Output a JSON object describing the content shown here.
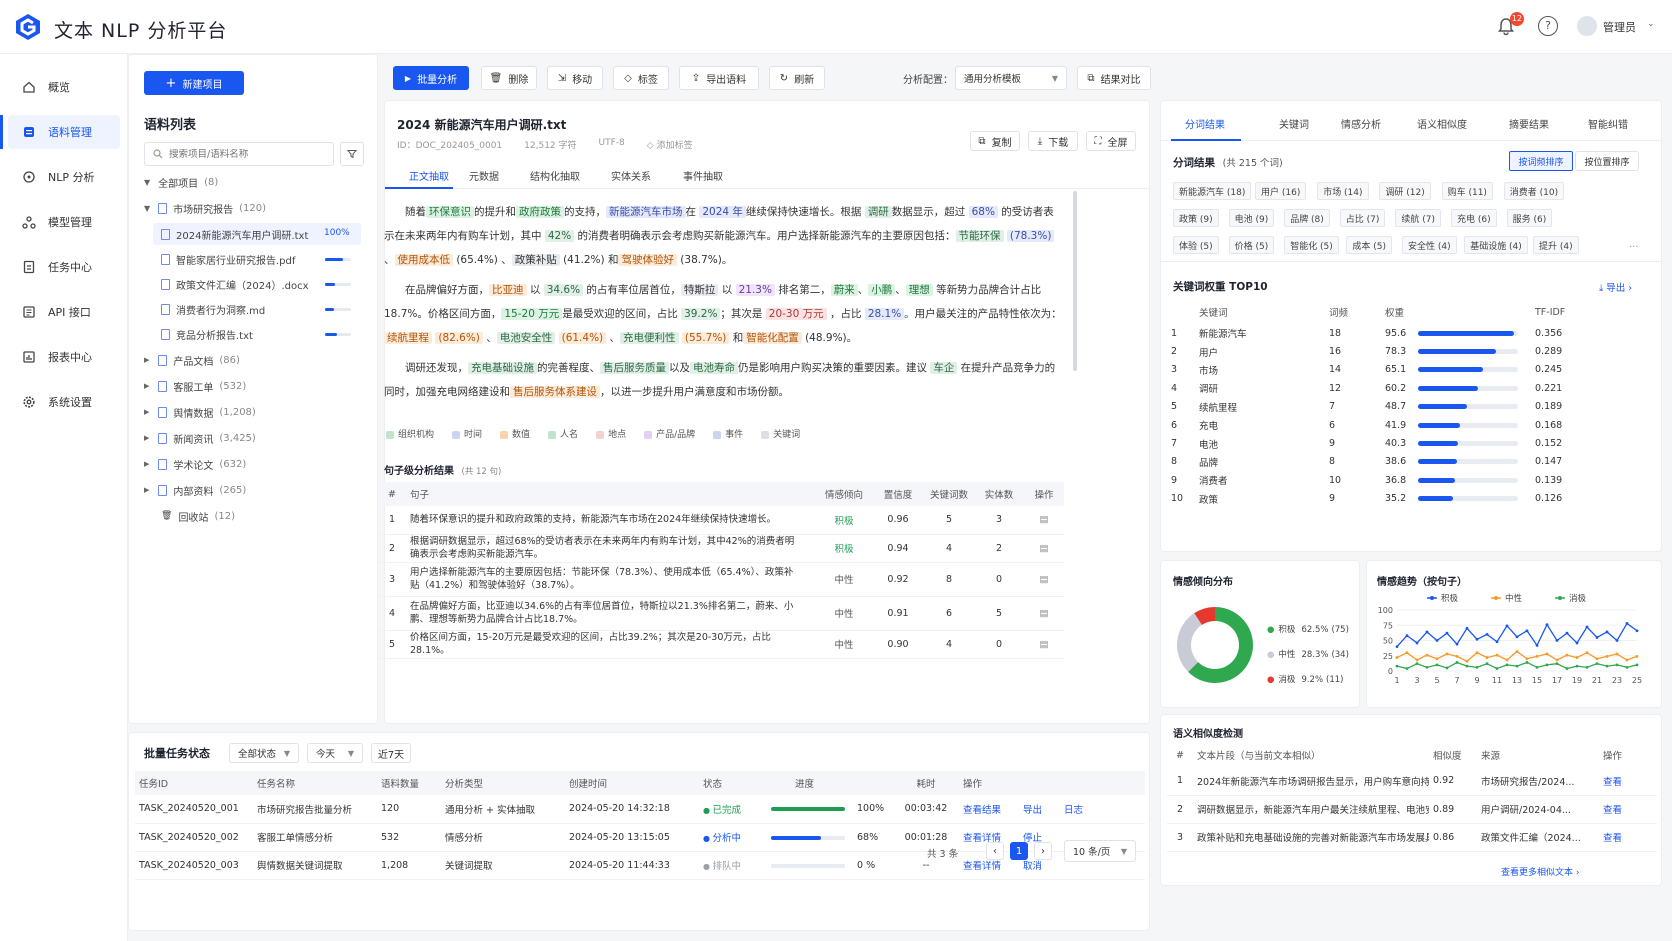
{
  "app": {
    "title": "文本 NLP 分析平台",
    "notif_count": "12",
    "user": "管理员"
  },
  "nav": {
    "items": [
      {
        "label": "概览",
        "icon": "home-icon"
      },
      {
        "label": "语料管理",
        "icon": "database-icon",
        "active": true
      },
      {
        "label": "NLP 分析",
        "icon": "nlp-icon"
      },
      {
        "label": "模型管理",
        "icon": "model-icon"
      },
      {
        "label": "任务中心",
        "icon": "task-icon"
      },
      {
        "label": "API 接口",
        "icon": "api-icon"
      },
      {
        "label": "报表中心",
        "icon": "report-icon"
      },
      {
        "label": "系统设置",
        "icon": "settings-icon"
      }
    ]
  },
  "corpus": {
    "new_button": "新建项目",
    "title": "语料列表",
    "search_placeholder": "搜索项目/语料名称",
    "all": {
      "label": "全部项目",
      "count": "(8)"
    },
    "market": {
      "label": "市场研究报告",
      "count": "(120)"
    },
    "files": [
      {
        "name": "2024新能源汽车用户调研.txt",
        "progress_text": "100%",
        "progress": 1.0,
        "active": true
      },
      {
        "name": "智能家居行业研究报告.pdf",
        "progress": 0.7
      },
      {
        "name": "政策文件汇编（2024）.docx",
        "progress": 0.4
      },
      {
        "name": "消费者行为洞察.md",
        "progress": 0.35
      },
      {
        "name": "竞品分析报告.txt",
        "progress": 0.45
      }
    ],
    "groups": [
      {
        "label": "产品文档",
        "count": "(86)"
      },
      {
        "label": "客服工单",
        "count": "(532)"
      },
      {
        "label": "舆情数据",
        "count": "(1,208)"
      },
      {
        "label": "新闻资讯",
        "count": "(3,425)"
      },
      {
        "label": "学术论文",
        "count": "(632)"
      },
      {
        "label": "内部资料",
        "count": "(265)"
      }
    ],
    "trash": {
      "label": "回收站",
      "count": "(12)"
    }
  },
  "toolbar": {
    "batch": "批量分析",
    "delete": "删除",
    "move": "移动",
    "tag": "标签",
    "export": "导出语料",
    "refresh": "刷新",
    "config_label": "分析配置：",
    "config_value": "通用分析模板",
    "compare": "结果对比"
  },
  "doc": {
    "title": "2024 新能源汽车用户调研.txt",
    "id": "ID：DOC_202405_0001",
    "chars": "12,512 字符",
    "encoding": "UTF-8",
    "add_tag": "添加标签",
    "copy": "复制",
    "download": "下载",
    "fullscreen": "全屏",
    "tabs": [
      "正文抽取",
      "元数据",
      "结构化抽取",
      "实体关系",
      "事件抽取"
    ],
    "legend": [
      "组织机构",
      "时间",
      "数值",
      "人名",
      "地点",
      "产品/品牌",
      "事件",
      "关键词"
    ]
  },
  "sentences": {
    "title": "句子级分析结果",
    "count": "(共 12 句)",
    "headers": [
      "#",
      "句子",
      "情感倾向",
      "置信度",
      "关键词数",
      "实体数",
      "操作"
    ],
    "rows": [
      {
        "n": "1",
        "text": "随着环保意识的提升和政府政策的支持，新能源汽车市场在2024年继续保持快速增长。",
        "sent": "积极",
        "conf": "0.96",
        "kw": "5",
        "ent": "3"
      },
      {
        "n": "2",
        "text": "根据调研数据显示，超过68%的受访者表示在未来两年内有购车计划，其中42%的消费者明确表示会考虑购买新能源汽车。",
        "sent": "积极",
        "conf": "0.94",
        "kw": "4",
        "ent": "2"
      },
      {
        "n": "3",
        "text": "用户选择新能源汽车的主要原因包括：节能环保（78.3%）、使用成本低（65.4%）、政策补贴（41.2%）和驾驶体验好（38.7%）。",
        "sent": "中性",
        "conf": "0.92",
        "kw": "8",
        "ent": "0"
      },
      {
        "n": "4",
        "text": "在品牌偏好方面，比亚迪以34.6%的占有率位居首位，特斯拉以21.3%排名第二，蔚来、小鹏、理想等新势力品牌合计占比18.7%。",
        "sent": "中性",
        "conf": "0.91",
        "kw": "6",
        "ent": "5"
      },
      {
        "n": "5",
        "text": "价格区间方面，15-20万元是最受欢迎的区间，占比39.2%；其次是20-30万元，占比28.1%。",
        "sent": "中性",
        "conf": "0.90",
        "kw": "4",
        "ent": "0"
      }
    ]
  },
  "tasks": {
    "title": "批量任务状态",
    "filter_status": "全部状态",
    "filter_day": "今天",
    "filter_7": "近7天",
    "headers": [
      "任务ID",
      "任务名称",
      "语料数量",
      "分析类型",
      "创建时间",
      "状态",
      "进度",
      "耗时",
      "操作"
    ],
    "rows": [
      {
        "id": "TASK_20240520_001",
        "name": "市场研究报告批量分析",
        "n": "120",
        "type": "通用分析 + 实体抽取",
        "time": "2024-05-20 14:32:18",
        "status": "已完成",
        "status_color": "#1f9d55",
        "progress": 1.0,
        "pct": "100%",
        "dur": "00:03:42",
        "a1": "查看结果",
        "a2": "导出",
        "a3": "日志"
      },
      {
        "id": "TASK_20240520_002",
        "name": "客服工单情感分析",
        "n": "532",
        "type": "情感分析",
        "time": "2024-05-20 13:15:05",
        "status": "分析中",
        "status_color": "#1a56f0",
        "progress": 0.68,
        "pct": "68%",
        "dur": "00:01:28",
        "a1": "查看详情",
        "a2": "停止",
        "a3": ""
      },
      {
        "id": "TASK_20240520_003",
        "name": "舆情数据关键词提取",
        "n": "1,208",
        "type": "关键词提取",
        "time": "2024-05-20 11:44:33",
        "status": "排队中",
        "status_color": "#9aa0ab",
        "progress": 0.0,
        "pct": "0 %",
        "dur": "--",
        "a1": "查看详情",
        "a2": "取消",
        "a3": ""
      }
    ],
    "total": "共 3 条",
    "page": "1",
    "page_size": "10 条/页"
  },
  "seg": {
    "tabs": [
      "分词结果",
      "关键词",
      "情感分析",
      "语义相似度",
      "摘要结果",
      "智能纠错"
    ],
    "title": "分词结果",
    "count": "(共 215 个词)",
    "sort_freq": "按词频排序",
    "sort_pos": "按位置排序",
    "tags": [
      [
        "新能源汽车 (18)",
        "用户 (16)",
        "市场 (14)",
        "调研 (12)",
        "购车 (11)",
        "消费者 (10)"
      ],
      [
        "政策 (9)",
        "电池 (9)",
        "品牌 (8)",
        "占比 (7)",
        "续航 (7)",
        "充电 (6)",
        "服务 (6)"
      ],
      [
        "体验 (5)",
        "价格 (5)",
        "智能化 (5)",
        "成本 (5)",
        "安全性 (4)",
        "基础设施 (4)",
        "提升 (4)"
      ]
    ],
    "more": "..."
  },
  "kw": {
    "title": "关键词权重 TOP10",
    "export": "导出",
    "headers": [
      "关键词",
      "词频",
      "权重",
      "TF-IDF"
    ],
    "rows": [
      {
        "n": "1",
        "word": "新能源汽车",
        "freq": "18",
        "w": "95.6",
        "tfidf": "0.356"
      },
      {
        "n": "2",
        "word": "用户",
        "freq": "16",
        "w": "78.3",
        "tfidf": "0.289"
      },
      {
        "n": "3",
        "word": "市场",
        "freq": "14",
        "w": "65.1",
        "tfidf": "0.245"
      },
      {
        "n": "4",
        "word": "调研",
        "freq": "12",
        "w": "60.2",
        "tfidf": "0.221"
      },
      {
        "n": "5",
        "word": "续航里程",
        "freq": "7",
        "w": "48.7",
        "tfidf": "0.189"
      },
      {
        "n": "6",
        "word": "充电",
        "freq": "6",
        "w": "41.9",
        "tfidf": "0.168"
      },
      {
        "n": "7",
        "word": "电池",
        "freq": "9",
        "w": "40.3",
        "tfidf": "0.152"
      },
      {
        "n": "8",
        "word": "品牌",
        "freq": "8",
        "w": "38.6",
        "tfidf": "0.147"
      },
      {
        "n": "9",
        "word": "消费者",
        "freq": "10",
        "w": "36.8",
        "tfidf": "0.139"
      },
      {
        "n": "10",
        "word": "政策",
        "freq": "9",
        "w": "35.2",
        "tfidf": "0.126"
      }
    ]
  },
  "sentiment": {
    "title": "情感倾向分布",
    "items": [
      {
        "label": "积极",
        "pct": "62.5%",
        "cnt": "(75)",
        "value": 62.5,
        "color": "#2fa84f"
      },
      {
        "label": "中性",
        "pct": "28.3%",
        "cnt": "(34)",
        "value": 28.3,
        "color": "#c9ccd6"
      },
      {
        "label": "消极",
        "pct": "9.2%",
        "cnt": "(11)",
        "value": 9.2,
        "color": "#e5382e"
      }
    ]
  },
  "trend": {
    "title": "情感趋势（按句子）",
    "chart_data": {
      "type": "line",
      "x": [
        1,
        2,
        3,
        4,
        5,
        6,
        7,
        8,
        9,
        10,
        11,
        12,
        13,
        14,
        15,
        16,
        17,
        18,
        19,
        20,
        21,
        22,
        23,
        24,
        25
      ],
      "ylim": [
        0,
        100
      ],
      "yticks": [
        0,
        25,
        50,
        75,
        100
      ],
      "xticks": [
        1,
        3,
        5,
        7,
        9,
        11,
        13,
        15,
        17,
        19,
        21,
        23,
        25
      ],
      "series": [
        {
          "name": "积极",
          "color": "#1a56f0",
          "values": [
            40,
            58,
            46,
            64,
            50,
            62,
            44,
            70,
            52,
            60,
            48,
            74,
            56,
            66,
            42,
            76,
            50,
            62,
            46,
            72,
            55,
            64,
            50,
            78,
            66
          ]
        },
        {
          "name": "中性",
          "color": "#f59a23",
          "values": [
            22,
            30,
            18,
            26,
            20,
            28,
            24,
            16,
            30,
            22,
            26,
            18,
            32,
            20,
            24,
            28,
            18,
            26,
            22,
            30,
            20,
            24,
            28,
            18,
            24
          ]
        },
        {
          "name": "消极",
          "color": "#2fa84f",
          "values": [
            8,
            4,
            12,
            6,
            10,
            5,
            14,
            8,
            6,
            12,
            4,
            10,
            8,
            14,
            6,
            10,
            12,
            4,
            8,
            6,
            12,
            8,
            10,
            6,
            10
          ]
        }
      ]
    }
  },
  "similar": {
    "title": "语义相似度检测",
    "headers": [
      "#",
      "文本片段（与当前文本相似）",
      "相似度",
      "来源",
      "操作"
    ],
    "rows": [
      {
        "n": "1",
        "text": "2024年新能源汽车市场调研报告显示，用户购车意向持续...",
        "sim": "0.92",
        "src": "市场研究报告/2024...",
        "op": "查看"
      },
      {
        "n": "2",
        "text": "调研数据显示，新能源汽车用户最关注续航里程、电池安...",
        "sim": "0.89",
        "src": "用户调研/2024-04...",
        "op": "查看"
      },
      {
        "n": "3",
        "text": "政策补贴和充电基础设施的完善对新能源汽车市场发展具...",
        "sim": "0.86",
        "src": "政策文件汇编（2024...",
        "op": "查看"
      }
    ],
    "more": "查看更多相似文本 ›"
  }
}
